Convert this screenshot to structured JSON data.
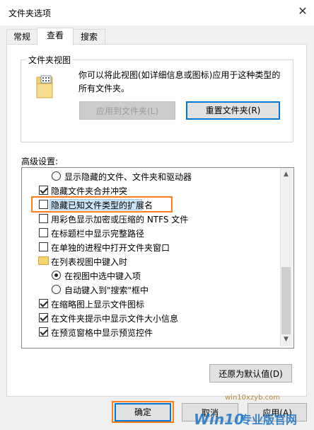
{
  "window": {
    "title": "文件夹选项",
    "close_glyph": "✕"
  },
  "tabs": [
    {
      "label": "常规",
      "active": false
    },
    {
      "label": "查看",
      "active": true
    },
    {
      "label": "搜索",
      "active": false
    }
  ],
  "folder_views": {
    "legend": "文件夹视图",
    "description": "你可以将此视图(如详细信息或图标)应用于这种类型的所有文件夹。",
    "apply_button": "应用到文件夹(L)",
    "reset_button": "重置文件夹(R)"
  },
  "advanced": {
    "label": "高级设置:",
    "items": [
      {
        "type": "radio",
        "checked": false,
        "label": "显示隐藏的文件、文件夹和驱动器"
      },
      {
        "type": "checkbox",
        "checked": true,
        "label": "隐藏文件夹合并冲突"
      },
      {
        "type": "checkbox",
        "checked": false,
        "label": "隐藏已知文件类型的扩展名",
        "selected": true
      },
      {
        "type": "checkbox",
        "checked": false,
        "label": "用彩色显示加密或压缩的 NTFS 文件"
      },
      {
        "type": "checkbox",
        "checked": false,
        "label": "在标题栏中显示完整路径"
      },
      {
        "type": "checkbox",
        "checked": false,
        "label": "在单独的进程中打开文件夹窗口"
      },
      {
        "type": "folder",
        "label": "在列表视图中键入时"
      },
      {
        "type": "radio",
        "checked": true,
        "label": "在视图中选中键入项"
      },
      {
        "type": "radio",
        "checked": false,
        "label": "自动键入到\"搜索\"框中"
      },
      {
        "type": "checkbox",
        "checked": true,
        "label": "在缩略图上显示文件图标"
      },
      {
        "type": "checkbox",
        "checked": true,
        "label": "在文件夹提示中显示文件大小信息"
      },
      {
        "type": "checkbox",
        "checked": true,
        "label": "在预览窗格中显示预览控件"
      }
    ],
    "restore_button": "还原为默认值(D)"
  },
  "footer": {
    "ok": "确定",
    "cancel": "取消",
    "apply": "应用(A)"
  },
  "watermark": {
    "site": "win10xzyb.com",
    "brand": "Win10 专业版官网"
  },
  "colors": {
    "accent": "#0078d7",
    "highlight": "#ff7d1a",
    "selection": "#cce4f7"
  }
}
